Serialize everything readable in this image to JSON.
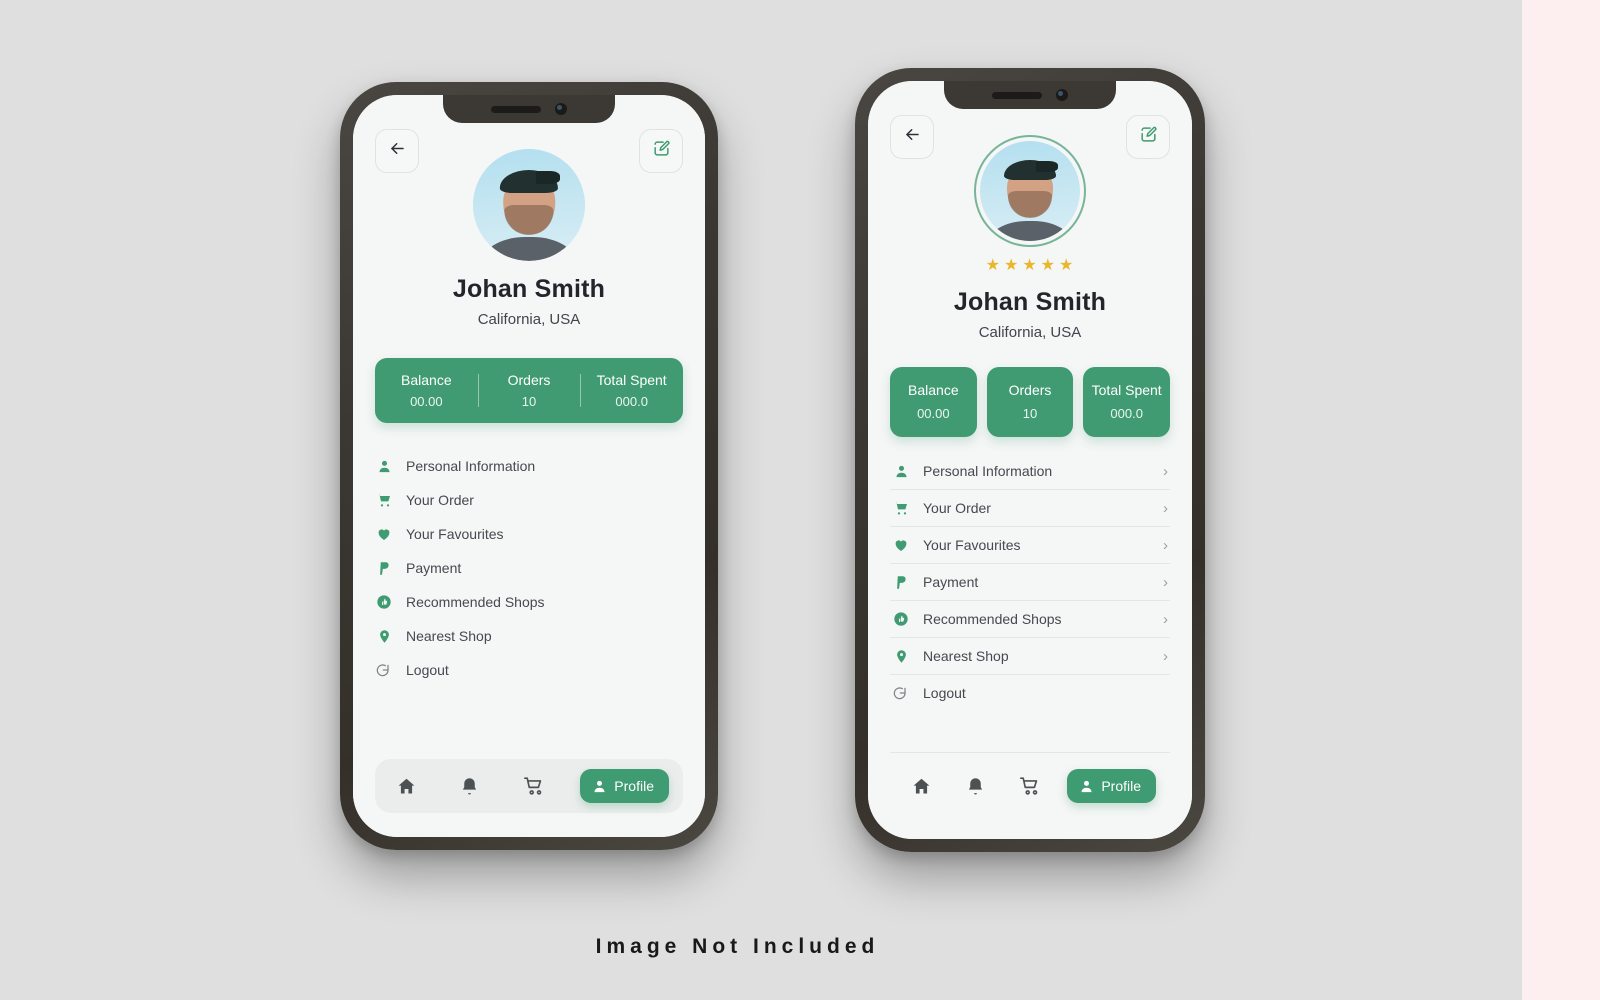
{
  "canvas": {
    "background_color": "#dfdfdf",
    "accent_strip_color": "#fdeff0",
    "caption": "Image Not Included"
  },
  "theme": {
    "green": "#419b72",
    "green_dark": "#3f9b71",
    "star_gold": "#e9b62c",
    "screen_bg": "#f5f6f6",
    "frame": "#3b3733",
    "text_dark": "#22262b",
    "text_muted": "#444a4f",
    "divider": "#e4e6e6"
  },
  "screens": [
    {
      "id": "profile-variant-a",
      "topbar": {
        "back_icon": "arrow-left-icon",
        "edit_icon": "edit-square-icon"
      },
      "avatar": {
        "icon": "user-avatar-photo",
        "ringed": false
      },
      "rating": {
        "visible": false,
        "stars": 0,
        "star_glyph": "★"
      },
      "user": {
        "name": "Johan Smith",
        "location": "California, USA"
      },
      "stats_style": "joined-bar",
      "stats": [
        {
          "label": "Balance",
          "value": "00.00"
        },
        {
          "label": "Orders",
          "value": "10"
        },
        {
          "label": "Total Spent",
          "value": "000.0"
        }
      ],
      "menu_style": "plain",
      "menu": [
        {
          "label": "Personal Information",
          "icon": "user-icon",
          "chevron": false
        },
        {
          "label": "Your Order",
          "icon": "cart-icon",
          "chevron": false
        },
        {
          "label": "Your Favourites",
          "icon": "heart-icon",
          "chevron": false
        },
        {
          "label": "Payment",
          "icon": "paypal-p-icon",
          "chevron": false
        },
        {
          "label": "Recommended Shops",
          "icon": "thumbs-up-icon",
          "chevron": false
        },
        {
          "label": "Nearest Shop",
          "icon": "map-pin-icon",
          "chevron": false
        },
        {
          "label": "Logout",
          "icon": "logout-icon",
          "chevron": false
        }
      ],
      "bottom_nav_style": "filled",
      "bottom_nav": [
        {
          "icon": "home-icon",
          "label": ""
        },
        {
          "icon": "bell-icon",
          "label": ""
        },
        {
          "icon": "cart-icon",
          "label": ""
        }
      ],
      "profile_button": {
        "label": "Profile",
        "icon": "user-icon"
      }
    },
    {
      "id": "profile-variant-b",
      "topbar": {
        "back_icon": "arrow-left-icon",
        "edit_icon": "edit-square-icon"
      },
      "avatar": {
        "icon": "user-avatar-photo",
        "ringed": true
      },
      "rating": {
        "visible": true,
        "stars": 5,
        "star_glyph": "★"
      },
      "user": {
        "name": "Johan Smith",
        "location": "California, USA"
      },
      "stats_style": "separate-cards",
      "stats": [
        {
          "label": "Balance",
          "value": "00.00"
        },
        {
          "label": "Orders",
          "value": "10"
        },
        {
          "label": "Total Spent",
          "value": "000.0"
        }
      ],
      "menu_style": "divided",
      "menu": [
        {
          "label": "Personal Information",
          "icon": "user-icon",
          "chevron": true
        },
        {
          "label": "Your Order",
          "icon": "cart-icon",
          "chevron": true
        },
        {
          "label": "Your Favourites",
          "icon": "heart-icon",
          "chevron": true
        },
        {
          "label": "Payment",
          "icon": "paypal-p-icon",
          "chevron": true
        },
        {
          "label": "Recommended Shops",
          "icon": "thumbs-up-icon",
          "chevron": true
        },
        {
          "label": "Nearest Shop",
          "icon": "map-pin-icon",
          "chevron": true
        },
        {
          "label": "Logout",
          "icon": "logout-icon",
          "chevron": false
        }
      ],
      "bottom_nav_style": "plain",
      "bottom_nav": [
        {
          "icon": "home-icon",
          "label": ""
        },
        {
          "icon": "bell-icon",
          "label": ""
        },
        {
          "icon": "cart-icon",
          "label": ""
        }
      ],
      "profile_button": {
        "label": "Profile",
        "icon": "user-icon"
      }
    }
  ]
}
